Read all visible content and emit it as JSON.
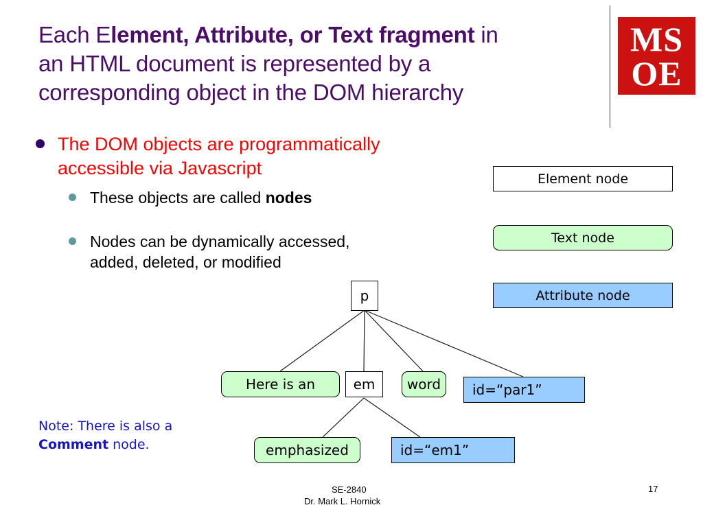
{
  "slide": {
    "title_parts": {
      "lead": "Each E",
      "bold": "lement, Attribute, or Text fragment",
      "tail": " in",
      "line2": "an HTML document is represented by a",
      "line3": "corresponding object in the DOM hierarchy"
    },
    "title_color": "#4b0d68"
  },
  "logo": {
    "line1": "MS",
    "line2": "OE",
    "background": "#cc1111",
    "text_color": "#ffffff"
  },
  "bullets": {
    "level1": {
      "text": "The DOM objects are programmatically accessible via Javascript",
      "color": "#ff0000",
      "marker_color": "#330066"
    },
    "level2": [
      {
        "pre": "These objects are called ",
        "bold": "nodes",
        "post": ""
      },
      {
        "pre": "Nodes can be dynamically accessed, added, deleted,  or modified",
        "bold": "",
        "post": ""
      }
    ],
    "level2_marker_color": "#5d9b9b"
  },
  "legend": [
    {
      "label": "Element node",
      "kind": "element",
      "fill": "#ffffff"
    },
    {
      "label": "Text node",
      "kind": "text",
      "fill": "#ccffcc"
    },
    {
      "label": "Attribute node",
      "kind": "attr",
      "fill": "#99ccff"
    }
  ],
  "tree": {
    "root": {
      "label": "p",
      "kind": "element"
    },
    "children": [
      {
        "label": "Here is an",
        "kind": "text"
      },
      {
        "label": "em",
        "kind": "element"
      },
      {
        "label": "word",
        "kind": "text"
      },
      {
        "label": "id=“par1”",
        "kind": "attr"
      }
    ],
    "grandchildren": [
      {
        "label": "emphasized",
        "kind": "text"
      },
      {
        "label": "id=“em1”",
        "kind": "attr"
      }
    ]
  },
  "note": {
    "pre": "Note: There is also a ",
    "bold": "Comment",
    "post": " node.",
    "color": "#1414c8"
  },
  "footer": {
    "course": "SE-2840",
    "author": "Dr. Mark L. Hornick",
    "page": "17"
  }
}
